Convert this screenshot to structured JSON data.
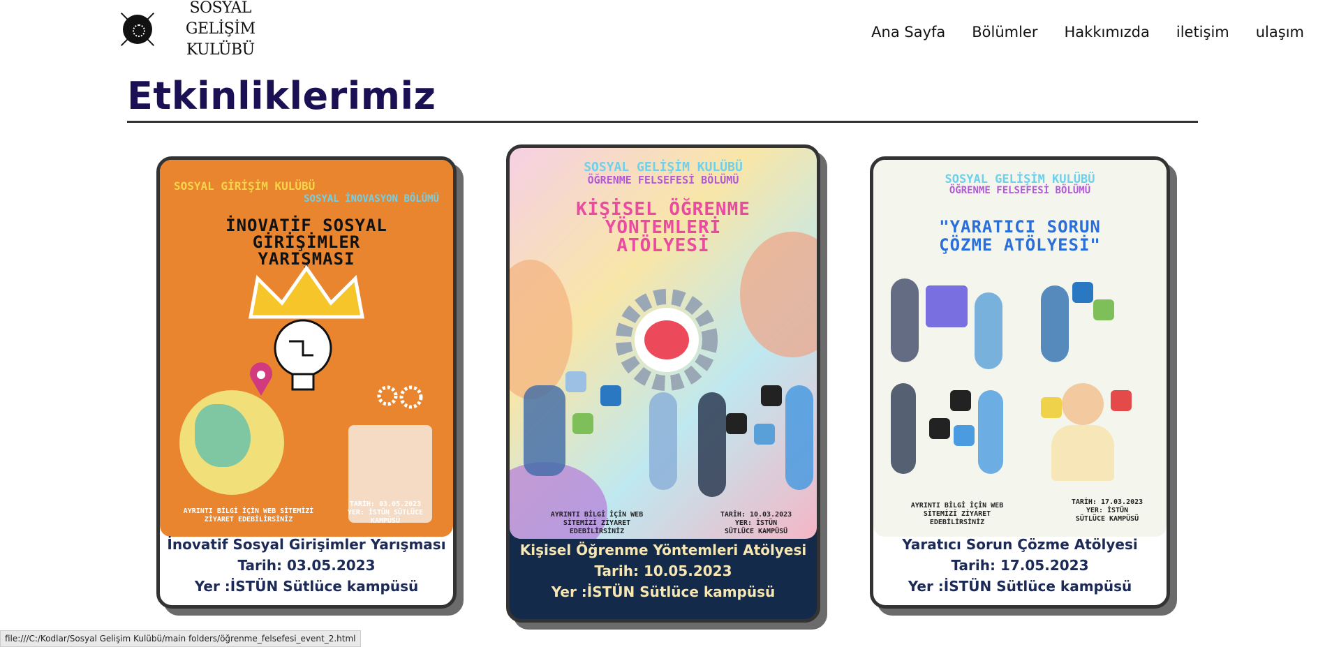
{
  "logo": {
    "line1": "SOSYAL GELİŞİM",
    "line2": "KULÜBÜ"
  },
  "nav": [
    "Ana Sayfa",
    "Bölümler",
    "Hakkımızda",
    "iletişim",
    "ulaşım"
  ],
  "page_title": "Etkinliklerimiz",
  "events": [
    {
      "poster": {
        "club": "SOSYAL GİRİŞİM KULÜBÜ",
        "section": "SOSYAL İNOVASYON BÖLÜMÜ",
        "headline": [
          "İNOVATİF SOSYAL",
          "GİRİŞİMLER",
          "YARIŞMASI"
        ],
        "info_left": [
          "AYRINTI BİLGİ İÇİN WEB SİTEMİZİ",
          "ZİYARET EDEBİLİRSİNİZ"
        ],
        "info_right": [
          "TARİH: 03.05.2023",
          "YER: İSTÜN SÜTLÜCE",
          "KAMPÜSÜ"
        ]
      },
      "title": "İnovatif Sosyal Girişimler Yarışması",
      "date": "Tarih: 03.05.2023",
      "place": "Yer :İSTÜN Sütlüce kampüsü"
    },
    {
      "poster": {
        "club": "SOSYAL GELİŞİM KULÜBÜ",
        "section": "ÖĞRENME FELSEFESİ BÖLÜMÜ",
        "headline": [
          "KİŞİSEL ÖĞRENME",
          "YÖNTEMLERİ",
          "ATÖLYESİ"
        ],
        "info_left": [
          "AYRINTI BİLGİ İÇİN WEB",
          "SİTEMİZİ ZİYARET",
          "EDEBİLİRSİNİZ"
        ],
        "info_right": [
          "TARİH: 10.03.2023",
          "YER: İSTÜN",
          "SÜTLÜCE KAMPÜSÜ"
        ]
      },
      "title": "Kişisel Öğrenme Yöntemleri Atölyesi",
      "date": "Tarih: 10.05.2023",
      "place": "Yer :İSTÜN Sütlüce kampüsü"
    },
    {
      "poster": {
        "club": "SOSYAL GELİŞİM KULÜBÜ",
        "section": "ÖĞRENME FELSEFESİ BÖLÜMÜ",
        "headline": [
          "\"YARATICI SORUN",
          "ÇÖZME ATÖLYESİ\""
        ],
        "info_left": [
          "AYRINTI BİLGİ İÇİN WEB",
          "SİTEMİZİ ZİYARET",
          "EDEBİLİRSİNİZ"
        ],
        "info_right": [
          "TARİH: 17.03.2023",
          "YER: İSTÜN",
          "SÜTLÜCE KAMPÜSÜ"
        ]
      },
      "title": "Yaratıcı Sorun Çözme Atölyesi",
      "date": "Tarih: 17.05.2023",
      "place": "Yer :İSTÜN Sütlüce kampüsü"
    }
  ],
  "status_url": "file:///C:/Kodlar/Sosyal Gelişim Kulübü/main folders/öğrenme_felsefesi_event_2.html"
}
